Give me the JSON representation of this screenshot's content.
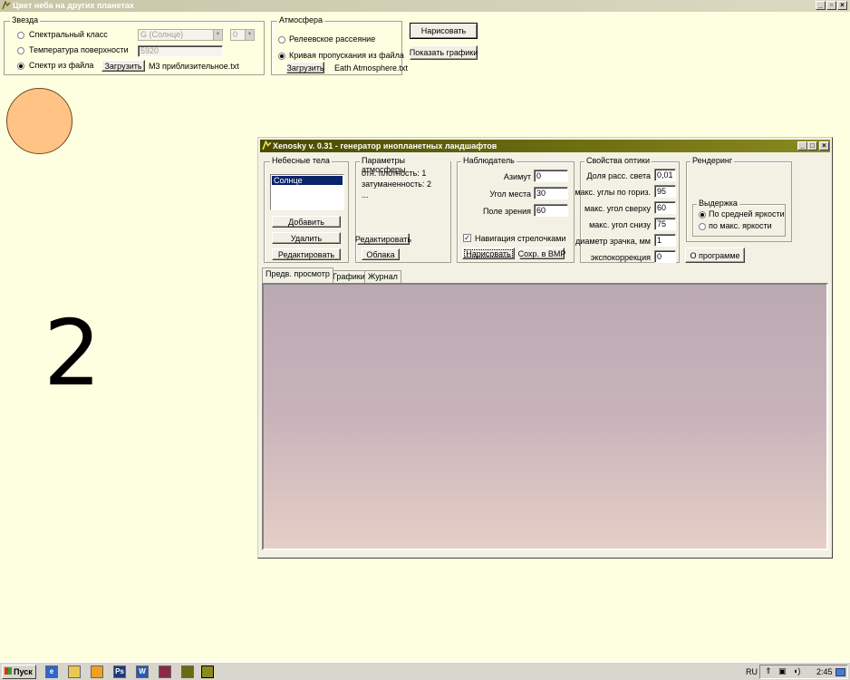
{
  "window": {
    "title": "Цвет неба на других планетах"
  },
  "star": {
    "group_label": "Звезда",
    "options": [
      {
        "label": "Спектральный класс",
        "selected": false
      },
      {
        "label": "Температура поверхности",
        "selected": false
      },
      {
        "label": "Спектр из файла",
        "selected": true
      }
    ],
    "class_value": "G (Солнце)",
    "subclass_value": "0",
    "temperature_value": "5920",
    "load_label": "Загрузить",
    "file_name": "M3 приблизительное.txt"
  },
  "atmosphere": {
    "group_label": "Атмосфера",
    "options": [
      {
        "label": "Релеевское рассеяние",
        "selected": false
      },
      {
        "label": "Кривая пропускания из файла",
        "selected": true
      }
    ],
    "load_label": "Загрузить",
    "file_name": "Eath Atmosphere.txt"
  },
  "actions": {
    "draw_label": "Нарисовать",
    "show_graphs_label": "Показать графики"
  },
  "canvas": {
    "big_number": "2",
    "sun_color": "#ffc485"
  },
  "xenosky": {
    "title": "Xenosky v. 0.31 - генератор инопланетных ландшафтов",
    "bodies": {
      "group_label": "Небесные тела",
      "items": [
        "Солнце"
      ],
      "add_label": "Добавить",
      "delete_label": "Удалить",
      "edit_label": "Редактировать"
    },
    "atm_params": {
      "group_label": "Параметры атмосферы",
      "lines": [
        "отн. плотность: 1",
        "затуманенность: 2",
        "..."
      ],
      "edit_label": "Редактировать",
      "clouds_label": "Облака"
    },
    "observer": {
      "group_label": "Наблюдатель",
      "fields": [
        {
          "label": "Азимут",
          "value": "0"
        },
        {
          "label": "Угол места",
          "value": "30"
        },
        {
          "label": "Поле зрения",
          "value": "60"
        }
      ],
      "nav_label": "Навигация стрелочками",
      "nav_checked": true,
      "draw_label": "Нарисовать",
      "save_bmp_label": "Сохр. в BMP"
    },
    "optics": {
      "group_label": "Свойства оптики",
      "fields": [
        {
          "label": "Доля расс. света",
          "value": "0,01"
        },
        {
          "label": "макс. углы по гориз.",
          "value": "95"
        },
        {
          "label": "макс. угол сверху",
          "value": "60"
        },
        {
          "label": "макс. угол снизу",
          "value": "75"
        },
        {
          "label": "диаметр зрачка, мм",
          "value": "1"
        },
        {
          "label": "экспокоррекция",
          "value": "0"
        }
      ]
    },
    "rendering": {
      "group_label": "Рендеринг",
      "exposure_label": "Выдержка",
      "options": [
        {
          "label": "По средней яркости",
          "selected": true
        },
        {
          "label": "по макс. яркости",
          "selected": false
        }
      ],
      "about_label": "О программе"
    },
    "tabs": [
      "Предв. просмотр",
      "Графики",
      "Журнал"
    ],
    "active_tab": 0
  },
  "taskbar": {
    "start_label": "Пуск",
    "lang": "RU",
    "clock": "2:45"
  }
}
